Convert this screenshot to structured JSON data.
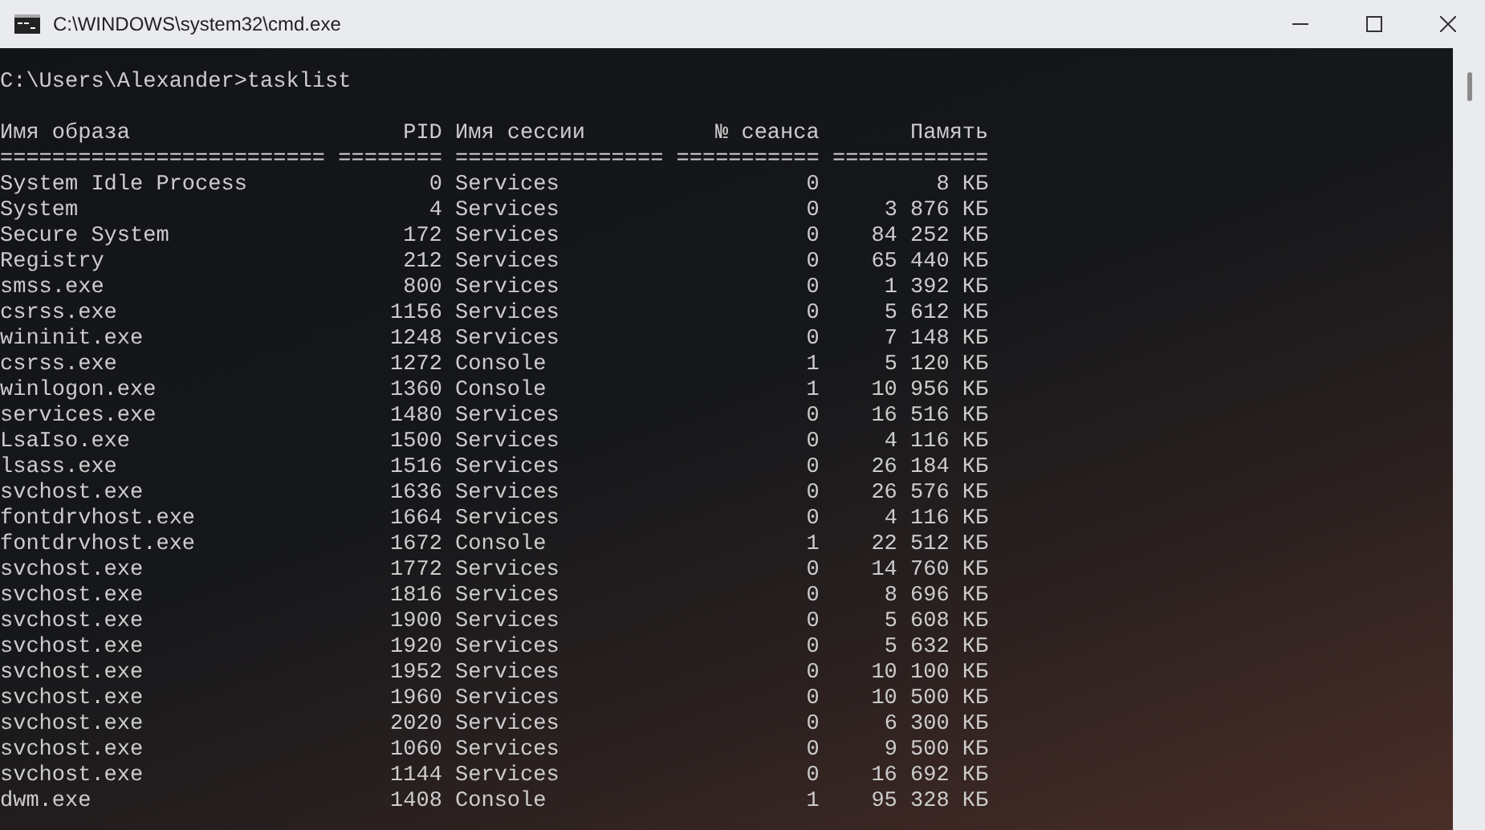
{
  "window": {
    "title": "C:\\WINDOWS\\system32\\cmd.exe"
  },
  "prompt": "C:\\Users\\Alexander>tasklist",
  "table": {
    "columns": [
      "Имя образа",
      "PID",
      "Имя сессии",
      "№ сеанса",
      "Память"
    ],
    "separator": "========================= ======== ================ =========== ============",
    "rows": [
      [
        "System Idle Process",
        "0",
        "Services",
        "0",
        "8 КБ"
      ],
      [
        "System",
        "4",
        "Services",
        "0",
        "3 876 КБ"
      ],
      [
        "Secure System",
        "172",
        "Services",
        "0",
        "84 252 КБ"
      ],
      [
        "Registry",
        "212",
        "Services",
        "0",
        "65 440 КБ"
      ],
      [
        "smss.exe",
        "800",
        "Services",
        "0",
        "1 392 КБ"
      ],
      [
        "csrss.exe",
        "1156",
        "Services",
        "0",
        "5 612 КБ"
      ],
      [
        "wininit.exe",
        "1248",
        "Services",
        "0",
        "7 148 КБ"
      ],
      [
        "csrss.exe",
        "1272",
        "Console",
        "1",
        "5 120 КБ"
      ],
      [
        "winlogon.exe",
        "1360",
        "Console",
        "1",
        "10 956 КБ"
      ],
      [
        "services.exe",
        "1480",
        "Services",
        "0",
        "16 516 КБ"
      ],
      [
        "LsaIso.exe",
        "1500",
        "Services",
        "0",
        "4 116 КБ"
      ],
      [
        "lsass.exe",
        "1516",
        "Services",
        "0",
        "26 184 КБ"
      ],
      [
        "svchost.exe",
        "1636",
        "Services",
        "0",
        "26 576 КБ"
      ],
      [
        "fontdrvhost.exe",
        "1664",
        "Services",
        "0",
        "4 116 КБ"
      ],
      [
        "fontdrvhost.exe",
        "1672",
        "Console",
        "1",
        "22 512 КБ"
      ],
      [
        "svchost.exe",
        "1772",
        "Services",
        "0",
        "14 760 КБ"
      ],
      [
        "svchost.exe",
        "1816",
        "Services",
        "0",
        "8 696 КБ"
      ],
      [
        "svchost.exe",
        "1900",
        "Services",
        "0",
        "5 608 КБ"
      ],
      [
        "svchost.exe",
        "1920",
        "Services",
        "0",
        "5 632 КБ"
      ],
      [
        "svchost.exe",
        "1952",
        "Services",
        "0",
        "10 100 КБ"
      ],
      [
        "svchost.exe",
        "1960",
        "Services",
        "0",
        "10 500 КБ"
      ],
      [
        "svchost.exe",
        "2020",
        "Services",
        "0",
        "6 300 КБ"
      ],
      [
        "svchost.exe",
        "1060",
        "Services",
        "0",
        "9 500 КБ"
      ],
      [
        "svchost.exe",
        "1144",
        "Services",
        "0",
        "16 692 КБ"
      ],
      [
        "dwm.exe",
        "1408",
        "Console",
        "1",
        "95 328 КБ"
      ]
    ]
  }
}
